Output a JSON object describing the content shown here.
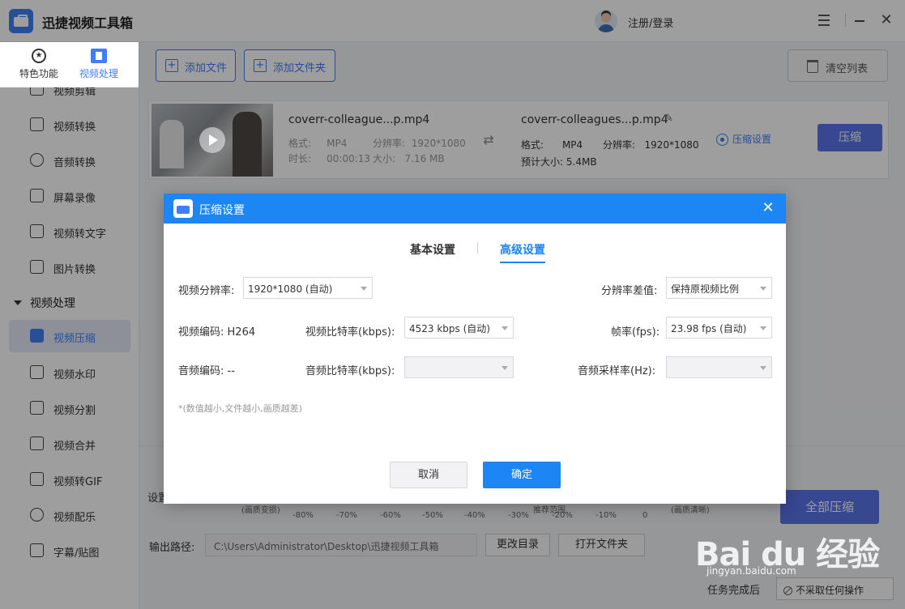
{
  "titlebar": {
    "app_title": "迅捷视频工具箱",
    "login": "注册/登录"
  },
  "sidebar": {
    "tabs": [
      {
        "label": "特色功能"
      },
      {
        "label": "视频处理"
      }
    ],
    "items": [
      {
        "label": "视频剪辑"
      },
      {
        "label": "视频转换"
      },
      {
        "label": "音频转换"
      },
      {
        "label": "屏幕录像"
      },
      {
        "label": "视频转文字"
      },
      {
        "label": "图片转换"
      }
    ],
    "group_label": "视频处理",
    "group_items": [
      {
        "label": "视频压缩"
      },
      {
        "label": "视频水印"
      },
      {
        "label": "视频分割"
      },
      {
        "label": "视频合并"
      },
      {
        "label": "视频转GIF"
      },
      {
        "label": "视频配乐"
      },
      {
        "label": "字幕/贴图"
      }
    ]
  },
  "toolbar": {
    "add_file": "添加文件",
    "add_folder": "添加文件夹",
    "clear_list": "清空列表"
  },
  "file": {
    "src_name": "coverr-colleague...p.mp4",
    "format_label": "格式:",
    "format": "MP4",
    "resolution_label": "分辨率:",
    "resolution": "1920*1080",
    "duration_label": "时长:",
    "duration": "00:00:13",
    "size_label": "大小:",
    "size": "7.16 MB",
    "dst_name": "coverr-colleagues...p.mp4",
    "dst_format": "MP4",
    "dst_resolution": "1920*1080",
    "est_size_label": "预计大小:",
    "est_size": "5.4MB",
    "settings_link": "压缩设置",
    "compress_button": "压缩"
  },
  "bottom": {
    "setting_label": "设置",
    "note_left": "(画质变损)",
    "note_mid": "推荐范围",
    "note_right": "(画质清晰)",
    "ticks": [
      "-80%",
      "-70%",
      "-60%",
      "-50%",
      "-40%",
      "-30%",
      "-20%",
      "-10%",
      "0"
    ],
    "output_label": "输出路径:",
    "output_path": "C:\\Users\\Administrator\\Desktop\\迅捷视频工具箱",
    "change_dir": "更改目录",
    "open_folder": "打开文件夹",
    "compress_all": "全部压缩",
    "done_label": "任务完成后",
    "done_value": "不采取任何操作"
  },
  "dialog": {
    "title": "压缩设置",
    "tab_basic": "基本设置",
    "tab_advanced": "高级设置",
    "video_res_label": "视频分辨率:",
    "video_res_value": "1920*1080 (自动)",
    "res_diff_label": "分辨率差值:",
    "res_diff_value": "保持原视频比例",
    "video_codec_label": "视频编码:",
    "video_codec": "H264",
    "video_bitrate_label": "视频比特率(kbps):",
    "video_bitrate_value": "4523 kbps (自动)",
    "fps_label": "帧率(fps):",
    "fps_value": "23.98 fps (自动)",
    "audio_codec_label": "音频编码:",
    "audio_codec": "--",
    "audio_bitrate_label": "音频比特率(kbps):",
    "audio_rate_label": "音频采样率(Hz):",
    "hint": "*(数值越小,文件越小,画质越差)",
    "cancel": "取消",
    "ok": "确定"
  },
  "watermark": {
    "logo": "Bai du 经验",
    "sub": "jingyan.baidu.com"
  }
}
